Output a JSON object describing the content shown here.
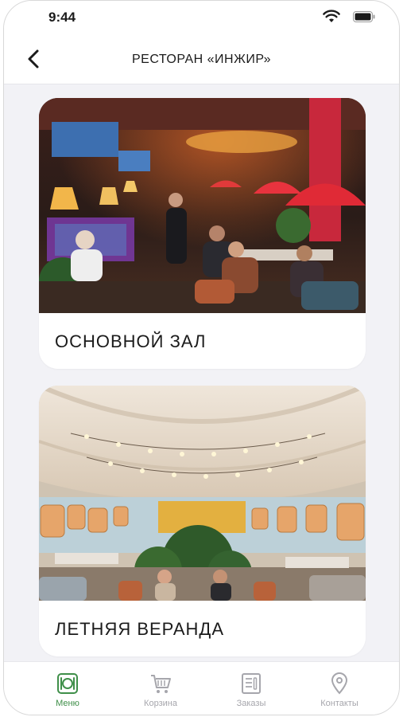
{
  "status_bar": {
    "time": "9:44"
  },
  "header": {
    "title": "РЕСТОРАН «ИНЖИР»",
    "back_icon": "chevron-left-icon"
  },
  "halls": [
    {
      "label": "ОСНОВНОЙ ЗАЛ"
    },
    {
      "label": "ЛЕТНЯЯ ВЕРАНДА"
    }
  ],
  "tab_bar": {
    "tabs": [
      {
        "label": "Меню",
        "icon": "plate-cutlery-icon",
        "active": true
      },
      {
        "label": "Корзина",
        "icon": "cart-icon",
        "active": false
      },
      {
        "label": "Заказы",
        "icon": "orders-icon",
        "active": false
      },
      {
        "label": "Контакты",
        "icon": "location-pin-icon",
        "active": false
      }
    ]
  },
  "colors": {
    "accent": "#3f8f49",
    "inactive": "#a6a6ac",
    "background": "#f2f2f6"
  }
}
